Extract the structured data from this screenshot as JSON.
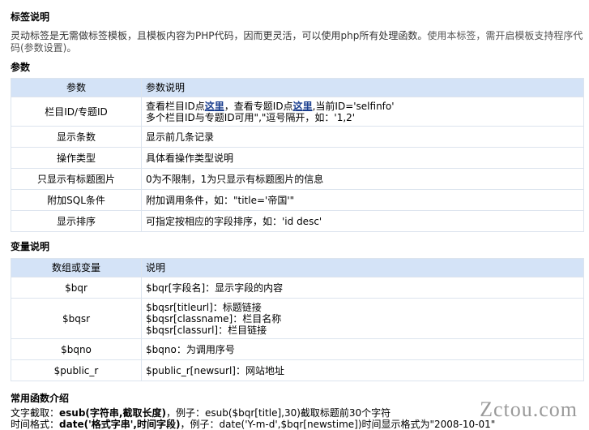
{
  "section_tag": {
    "title": "标签说明",
    "intro": "灵动标签是无需做标签模板，且模板内容为PHP代码，因而更灵活，可以使用php所有处理函数。",
    "intro_note": "使用本标签，需开启模板支持程序代码(参数设置)。"
  },
  "section_params": {
    "title": "参数",
    "header": [
      "参数",
      "参数说明"
    ],
    "rows": [
      {
        "name": "栏目ID/专题ID",
        "desc_parts": [
          "查看栏目ID点",
          "这里",
          "，查看专题ID点",
          "这里",
          ",当前ID='selfinfo'"
        ],
        "desc_line2": "多个栏目ID与专题ID可用\",\"逗号隔开，如：'1,2'"
      },
      {
        "name": "显示条数",
        "desc": "显示前几条记录"
      },
      {
        "name": "操作类型",
        "desc": "具体看操作类型说明"
      },
      {
        "name": "只显示有标题图片",
        "desc": "0为不限制，1为只显示有标题图片的信息"
      },
      {
        "name": "附加SQL条件",
        "desc": "附加调用条件，如：\"title='帝国'\""
      },
      {
        "name": "显示排序",
        "desc": "可指定按相应的字段排序，如：'id desc'"
      }
    ]
  },
  "section_vars": {
    "title": "变量说明",
    "header": [
      "数组或变量",
      "说明"
    ],
    "rows": [
      {
        "name": "$bqr",
        "lines": [
          "$bqr[字段名]：显示字段的内容"
        ]
      },
      {
        "name": "$bqsr",
        "lines": [
          "$bqsr[titleurl]：标题链接",
          "$bqsr[classname]：栏目名称",
          "$bqsr[classurl]：栏目链接"
        ]
      },
      {
        "name": "$bqno",
        "lines": [
          "$bqno：为调用序号"
        ]
      },
      {
        "name": "$public_r",
        "lines": [
          "$public_r[newsurl]：网站地址"
        ]
      }
    ]
  },
  "section_funcs": {
    "title": "常用函数介绍",
    "line1_prefix": "文字截取：",
    "line1_fn": "esub(字符串,截取长度)",
    "line1_rest": "，例子：esub($bqr[title],30)截取标题前30个字符",
    "line2_prefix": "时间格式：",
    "line2_fn": "date('格式字串',时间字段)",
    "line2_rest": "，例子：date('Y-m-d',$bqr[newstime])时间显示格式为\"2008-10-01\""
  },
  "watermark": "Zctou.com"
}
